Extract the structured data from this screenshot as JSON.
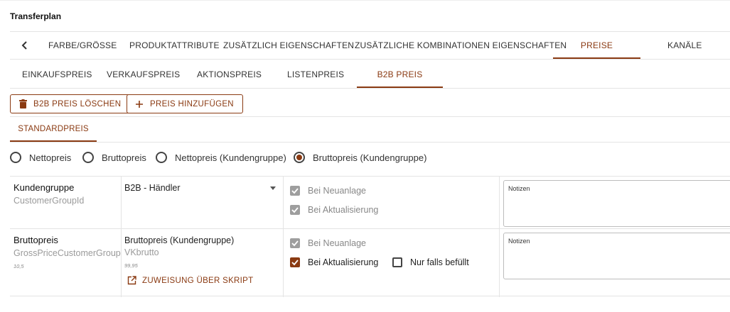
{
  "page": {
    "title": "Transferplan"
  },
  "colors": {
    "accent": "#8a3a12",
    "border": "#e4e4e4",
    "muted": "#9a9a9a"
  },
  "main_tabs": [
    {
      "label": "FARBE/GRÖSSE",
      "active": false
    },
    {
      "label": "PRODUKTATTRIBUTE",
      "active": false
    },
    {
      "label": "ZUSÄTZLICH EIGENSCHAFTEN",
      "active": false
    },
    {
      "label": "ZUSÄTZLICHE KOMBINATIONEN EIGENSCHAFTEN",
      "active": false
    },
    {
      "label": "PREISE",
      "active": true
    },
    {
      "label": "KANÄLE",
      "active": false
    }
  ],
  "sub_tabs": [
    {
      "label": "EINKAUFSPREIS",
      "active": false
    },
    {
      "label": "VERKAUFSPREIS",
      "active": false
    },
    {
      "label": "AKTIONSPREIS",
      "active": false
    },
    {
      "label": "LISTENPREIS",
      "active": false
    },
    {
      "label": "B2B PREIS",
      "active": true
    }
  ],
  "actions": {
    "delete_label": "B2B PREIS LÖSCHEN",
    "delete_icon": "trash-icon",
    "add_label": "PREIS HINZUFÜGEN",
    "add_icon": "plus-icon"
  },
  "price_tabs": [
    {
      "label": "STANDARDPREIS",
      "active": true
    }
  ],
  "price_type": {
    "options": [
      "Nettopreis",
      "Bruttopreis",
      "Nettopreis (Kundengruppe)",
      "Bruttopreis (Kundengruppe)"
    ],
    "selected": "Bruttopreis (Kundengruppe)"
  },
  "rows": [
    {
      "label": "Kundengruppe",
      "field": "CustomerGroupId",
      "select_value": "B2B - Händler",
      "checkboxes": [
        {
          "label": "Bei Neuanlage",
          "checked": true,
          "disabled": true
        },
        {
          "label": "Bei Aktualisierung",
          "checked": true,
          "disabled": true
        }
      ],
      "notes_placeholder": "Notizen"
    },
    {
      "label": "Bruttopreis",
      "field": "GrossPriceCustomerGroup",
      "sample": "10,5",
      "value_title": "Bruttopreis (Kundengruppe)",
      "value_field": "VKbrutto",
      "value_sample": "99,95",
      "script_label": "ZUWEISUNG ÜBER SKRIPT",
      "script_icon": "open-external-icon",
      "checkboxes": [
        {
          "label": "Bei Neuanlage",
          "checked": true,
          "disabled": true
        },
        {
          "label": "Bei Aktualisierung",
          "checked": true,
          "disabled": false
        },
        {
          "label": "Nur falls befüllt",
          "checked": false,
          "disabled": false
        }
      ],
      "notes_placeholder": "Notizen"
    }
  ]
}
